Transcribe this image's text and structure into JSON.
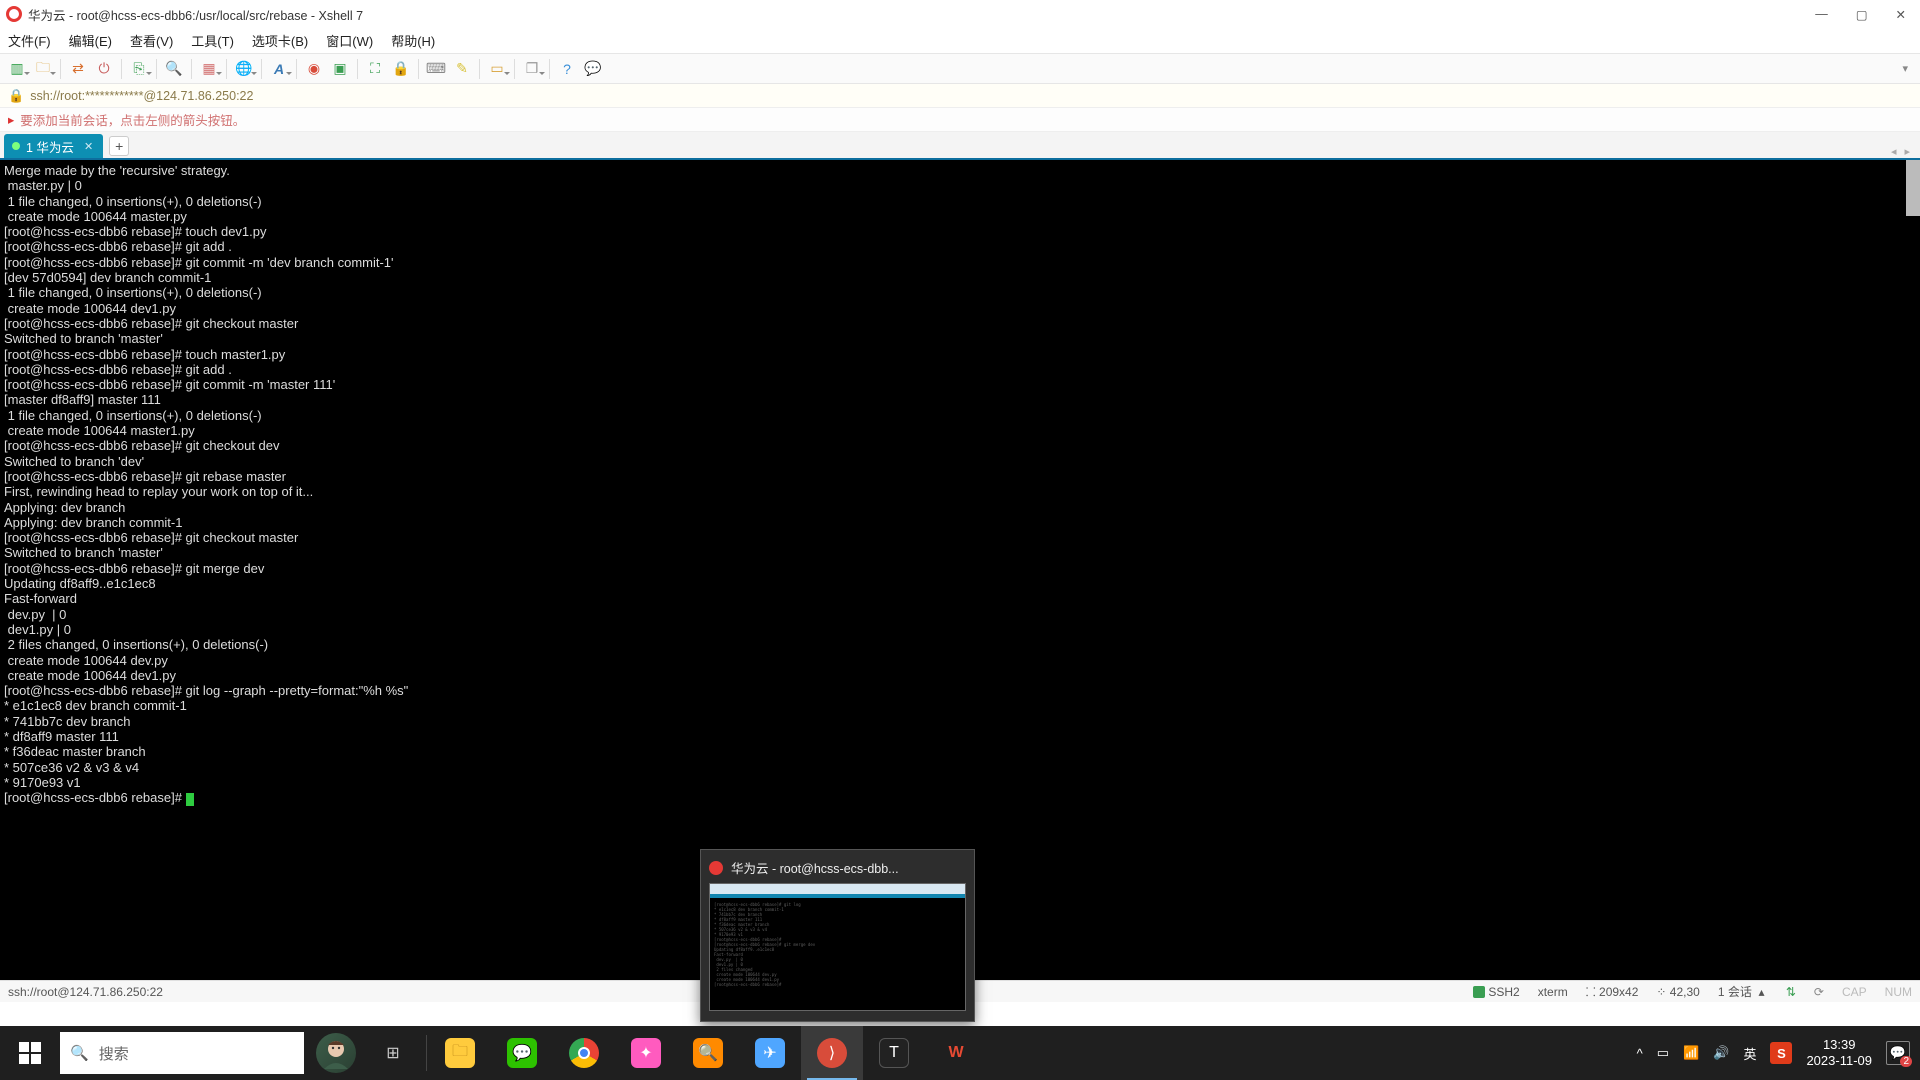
{
  "window": {
    "title": "华为云 - root@hcss-ecs-dbb6:/usr/local/src/rebase - Xshell 7"
  },
  "menu": {
    "file": "文件(F)",
    "edit": "编辑(E)",
    "view": "查看(V)",
    "tools": "工具(T)",
    "tabs": "选项卡(B)",
    "window": "窗口(W)",
    "help": "帮助(H)"
  },
  "address": {
    "text": "ssh://root:************@124.71.86.250:22"
  },
  "hint": {
    "text": "要添加当前会话，点击左侧的箭头按钮。"
  },
  "tab": {
    "label": "1 华为云"
  },
  "terminal": {
    "content": "Merge made by the 'recursive' strategy.\n master.py | 0\n 1 file changed, 0 insertions(+), 0 deletions(-)\n create mode 100644 master.py\n[root@hcss-ecs-dbb6 rebase]# touch dev1.py\n[root@hcss-ecs-dbb6 rebase]# git add .\n[root@hcss-ecs-dbb6 rebase]# git commit -m 'dev branch commit-1'\n[dev 57d0594] dev branch commit-1\n 1 file changed, 0 insertions(+), 0 deletions(-)\n create mode 100644 dev1.py\n[root@hcss-ecs-dbb6 rebase]# git checkout master\nSwitched to branch 'master'\n[root@hcss-ecs-dbb6 rebase]# touch master1.py\n[root@hcss-ecs-dbb6 rebase]# git add .\n[root@hcss-ecs-dbb6 rebase]# git commit -m 'master 111'\n[master df8aff9] master 111\n 1 file changed, 0 insertions(+), 0 deletions(-)\n create mode 100644 master1.py\n[root@hcss-ecs-dbb6 rebase]# git checkout dev\nSwitched to branch 'dev'\n[root@hcss-ecs-dbb6 rebase]# git rebase master\nFirst, rewinding head to replay your work on top of it...\nApplying: dev branch\nApplying: dev branch commit-1\n[root@hcss-ecs-dbb6 rebase]# git checkout master\nSwitched to branch 'master'\n[root@hcss-ecs-dbb6 rebase]# git merge dev\nUpdating df8aff9..e1c1ec8\nFast-forward\n dev.py  | 0\n dev1.py | 0\n 2 files changed, 0 insertions(+), 0 deletions(-)\n create mode 100644 dev.py\n create mode 100644 dev1.py\n[root@hcss-ecs-dbb6 rebase]# git log --graph --pretty=format:\"%h %s\"\n* e1c1ec8 dev branch commit-1\n* 741bb7c dev branch\n* df8aff9 master 111\n* f36deac master branch\n* 507ce36 v2 & v3 & v4\n* 9170e93 v1\n[root@hcss-ecs-dbb6 rebase]# "
  },
  "status": {
    "left": "ssh://root@124.71.86.250:22",
    "proto": "SSH2",
    "term": "xterm",
    "size": "209x42",
    "cursor": "42,30",
    "sessions": "1 会话",
    "cap": "CAP",
    "num": "NUM"
  },
  "taskbar": {
    "search_placeholder": "搜索",
    "ime_lang": "英",
    "ime_brand": "S",
    "time": "13:39",
    "date": "2023-11-09",
    "notif_count": "2"
  },
  "preview": {
    "title": "华为云 - root@hcss-ecs-dbb..."
  }
}
